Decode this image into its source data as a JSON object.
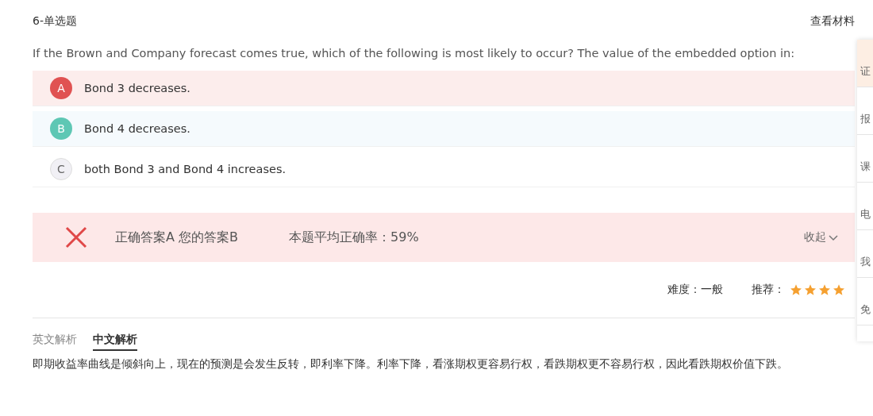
{
  "header": {
    "title": "6-单选题",
    "link": "查看材料"
  },
  "question": "If the Brown and Company forecast comes true, which of the following is most likely to occur? The value of the embedded option in:",
  "options": [
    {
      "letter": "A",
      "text": "Bond 3 decreases.",
      "kind": "correct"
    },
    {
      "letter": "B",
      "text": "Bond 4 decreases.",
      "kind": "chosen"
    },
    {
      "letter": "C",
      "text": "both Bond 3 and Bond 4 increases.",
      "kind": "plain"
    }
  ],
  "result": {
    "correct": false,
    "answers": "正确答案A 您的答案B",
    "rate": "本题平均正确率：59%",
    "toggle": "收起"
  },
  "meta": {
    "difficulty": "难度：一般",
    "recommend_label": "推荐：",
    "stars": 4
  },
  "tabs": [
    {
      "label": "英文解析",
      "selected": false
    },
    {
      "label": "中文解析",
      "selected": true
    }
  ],
  "explanation": "即期收益率曲线是倾斜向上，现在的预测是会发生反转，即利率下降。利率下降，看涨期权更容易行权，看跌期权更不容易行权，因此看跌期权价值下跌。",
  "side_panel": [
    {
      "label": "证",
      "selected": true
    },
    {
      "label": "报",
      "selected": false
    },
    {
      "label": "课",
      "selected": false
    },
    {
      "label": "电",
      "selected": false
    },
    {
      "label": "我",
      "selected": false
    },
    {
      "label": "免",
      "selected": false
    }
  ]
}
